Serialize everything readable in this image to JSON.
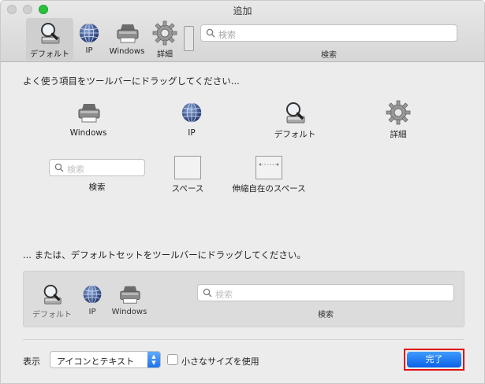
{
  "window": {
    "title": "追加"
  },
  "toolbar": {
    "items": [
      {
        "label": "デフォルト",
        "icon": "magnifier-icon",
        "selected": true
      },
      {
        "label": "IP",
        "icon": "globe-icon"
      },
      {
        "label": "Windows",
        "icon": "printer-icon"
      },
      {
        "label": "詳細",
        "icon": "gear-icon"
      }
    ],
    "search": {
      "placeholder": "検索",
      "label": "検索"
    }
  },
  "sheet": {
    "intro": "よく使う項目をツールバーにドラッグしてください...",
    "items": {
      "windows": "Windows",
      "ip": "IP",
      "default": "デフォルト",
      "details": "詳細",
      "search_placeholder": "検索",
      "search": "検索",
      "space": "スペース",
      "flex_space": "伸縮自在のスペース"
    },
    "default_set_intro": "... または、デフォルトセットをツールバーにドラッグしてください。",
    "default_set": {
      "default": "デフォルト",
      "ip": "IP",
      "windows": "Windows",
      "search_placeholder": "検索",
      "search": "検索"
    },
    "bottom": {
      "show_label": "表示",
      "show_value": "アイコンとテキスト",
      "small_size_label": "小さなサイズを使用",
      "small_size_checked": false,
      "done": "完了"
    }
  },
  "colors": {
    "accent": "#0a62e6",
    "highlight": "#e01010"
  }
}
